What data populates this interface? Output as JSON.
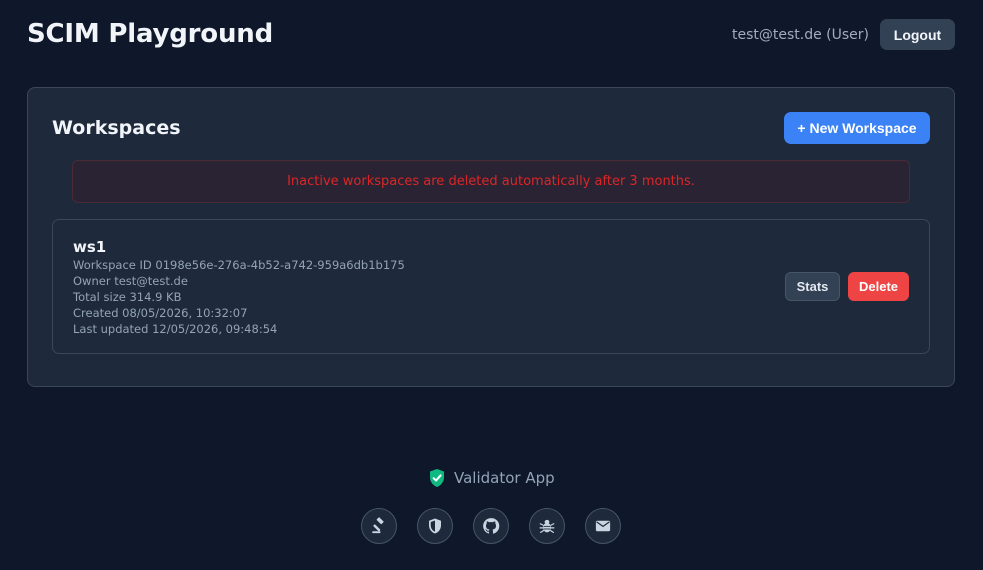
{
  "header": {
    "title": "SCIM Playground",
    "user": "test@test.de (User)",
    "logout_label": "Logout"
  },
  "workspaces": {
    "title": "Workspaces",
    "new_button_label": "+ New Workspace",
    "notice": "Inactive workspaces are deleted automatically after 3 months.",
    "items": [
      {
        "name": "ws1",
        "id_line": "Workspace ID 0198e56e-276a-4b52-a742-959a6db1b175",
        "owner_line": "Owner test@test.de",
        "size_line": "Total size 314.9 KB",
        "created_line": "Created 08/05/2026, 10:32:07",
        "updated_line": "Last updated 12/05/2026, 09:48:54",
        "stats_label": "Stats",
        "delete_label": "Delete"
      }
    ]
  },
  "footer": {
    "validator_label": "Validator App",
    "icons": [
      "gavel-icon",
      "shield-icon",
      "github-icon",
      "bug-icon",
      "mail-icon"
    ]
  },
  "colors": {
    "background": "#0f172a",
    "panel": "#1e293b",
    "primary": "#3b82f6",
    "danger": "#ef4444",
    "notice_text": "#dc2626",
    "validator_shield": "#10b981"
  }
}
